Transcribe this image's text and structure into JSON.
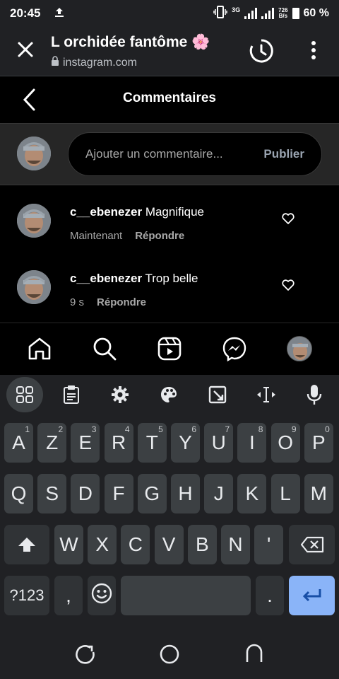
{
  "status": {
    "time": "20:45",
    "network": "3G",
    "speed_value": "726",
    "speed_unit": "B/s",
    "battery": "60 %"
  },
  "tab": {
    "title": "L orchidée fantôme 🌸",
    "url": "instagram.com"
  },
  "header": {
    "title": "Commentaires"
  },
  "composer": {
    "placeholder": "Ajouter un commentaire...",
    "post_label": "Publier"
  },
  "comments": [
    {
      "username": "c__ebenezer",
      "text": "Magnifique",
      "time": "Maintenant",
      "reply": "Répondre"
    },
    {
      "username": "c__ebenezer",
      "text": "Trop belle",
      "time": "9 s",
      "reply": "Répondre"
    }
  ],
  "nav": {
    "icons": [
      "home-icon",
      "search-icon",
      "reels-icon",
      "messenger-icon",
      "profile-avatar"
    ]
  },
  "keyboard": {
    "toolbar": [
      "apps-grid-icon",
      "clipboard-icon",
      "settings-gear-icon",
      "palette-icon",
      "resize-icon",
      "text-cursor-icon",
      "microphone-icon"
    ],
    "row1": [
      {
        "k": "A",
        "s": "1"
      },
      {
        "k": "Z",
        "s": "2"
      },
      {
        "k": "E",
        "s": "3"
      },
      {
        "k": "R",
        "s": "4"
      },
      {
        "k": "T",
        "s": "5"
      },
      {
        "k": "Y",
        "s": "6"
      },
      {
        "k": "U",
        "s": "7"
      },
      {
        "k": "I",
        "s": "8"
      },
      {
        "k": "O",
        "s": "9"
      },
      {
        "k": "P",
        "s": "0"
      }
    ],
    "row2": [
      "Q",
      "S",
      "D",
      "F",
      "G",
      "H",
      "J",
      "K",
      "L",
      "M"
    ],
    "row3": [
      "W",
      "X",
      "C",
      "V",
      "B",
      "N",
      "'"
    ],
    "symbols": "?123",
    "comma": ",",
    "period": "."
  },
  "colors": {
    "accent": "#8ab4f8",
    "background": "#000000",
    "keyboard": "#202124"
  }
}
